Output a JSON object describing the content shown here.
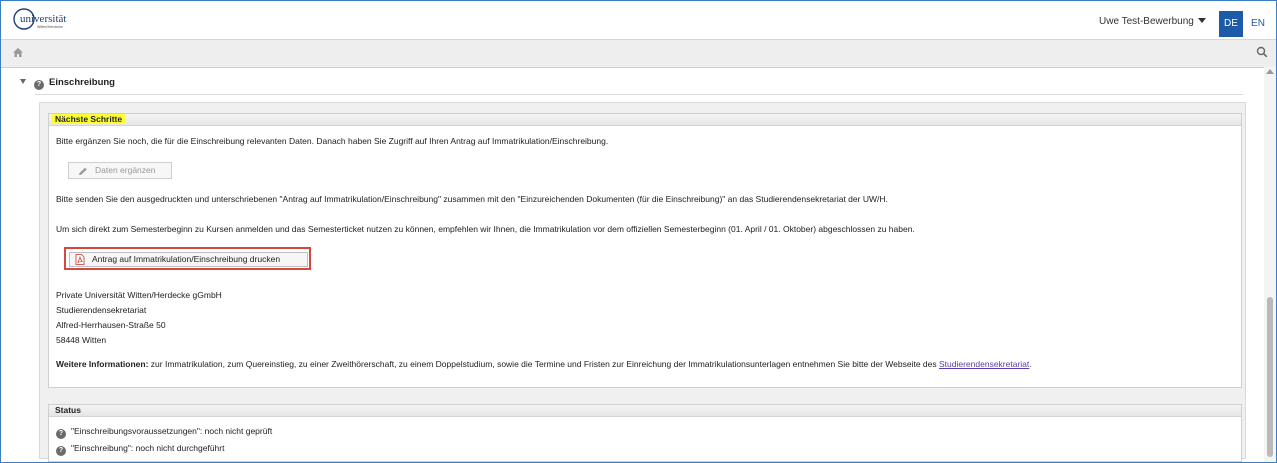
{
  "header": {
    "logo": {
      "text": "universität",
      "subtext": "Witten/Herdecke"
    },
    "user_menu": "Uwe Test-Bewerbung",
    "languages": [
      "DE",
      "EN"
    ]
  },
  "navbar": {
    "home_icon": "home-icon",
    "search_icon": "search-icon"
  },
  "section": {
    "title": "Einschreibung"
  },
  "next_steps": {
    "title": "Nächste Schritte",
    "intro": "Bitte ergänzen Sie noch, die für die Einschreibung relevanten Daten. Danach haben Sie Zugriff auf Ihren Antrag auf Immatrikulation/Einschreibung.",
    "complete_button": "Daten ergänzen",
    "send_text": "Bitte senden Sie den ausgedruckten und unterschriebenen \"Antrag auf Immatrikulation/Einschreibung\" zusammen mit den \"Einzureichenden Dokumenten (für die Einschreibung)\" an das Studierendensekretariat der UW/H.",
    "semester_text": "Um sich direkt zum Semesterbeginn zu Kursen anmelden und das Semesterticket nutzen zu können, empfehlen wir Ihnen, die Immatrikulation vor dem offiziellen Semesterbeginn (01. April / 01. Oktober) abgeschlossen zu haben.",
    "print_button": "Antrag auf Immatrikulation/Einschreibung drucken",
    "address": [
      "Private Universität Witten/Herdecke gGmbH",
      "Studierendensekretariat",
      "Alfred-Herrhausen-Straße 50",
      "58448 Witten"
    ],
    "more_info_label": "Weitere Informationen:",
    "more_info_text": " zur Immatrikulation, zum Quereinstieg, zu einer Zweithörerschaft, zu einem Doppelstudium, sowie die Termine und Fristen zur Einreichung der Immatrikulationsunterlagen entnehmen Sie bitte der Webseite des ",
    "more_info_link": "Studierendensekretariat",
    "more_info_end": "."
  },
  "status": {
    "title": "Status",
    "items": [
      "\"Einschreibungsvoraussetzungen\": noch nicht geprüft",
      "\"Einschreibung\": noch nicht durchgeführt"
    ]
  },
  "colors": {
    "accent": "#1d5aa8",
    "highlight": "#ffff33",
    "print_border": "#d3473c"
  }
}
